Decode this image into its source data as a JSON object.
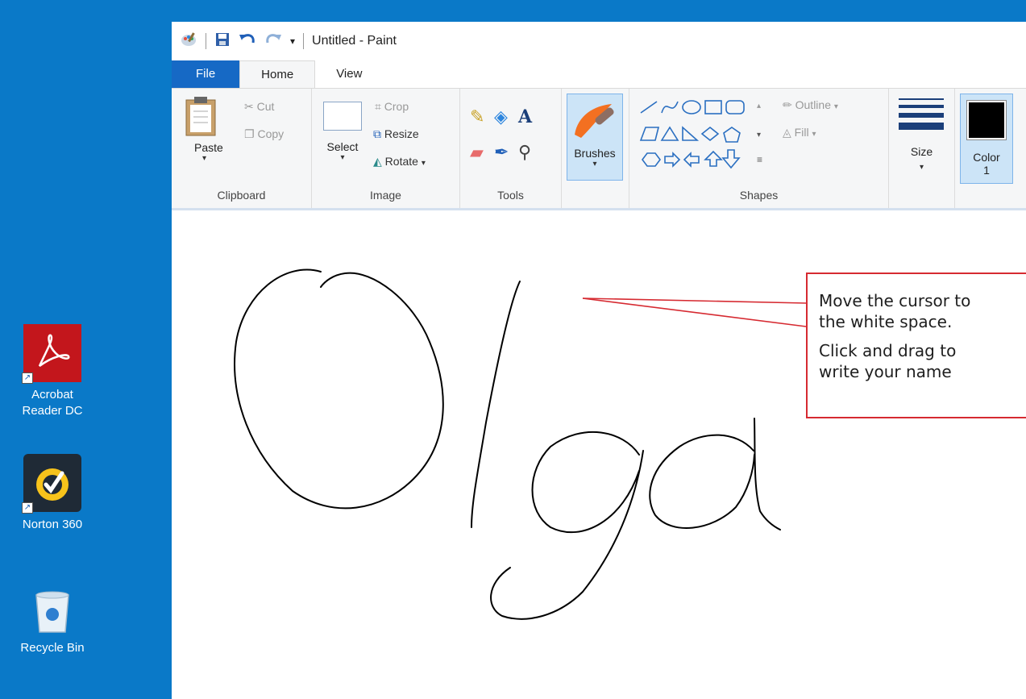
{
  "desktop": {
    "icons": [
      {
        "label_line1": "Acrobat",
        "label_line2": "Reader DC",
        "icon": "acrobat-icon"
      },
      {
        "label": "Norton 360",
        "icon": "norton-icon"
      },
      {
        "label": "Recycle Bin",
        "icon": "recycle-bin-icon"
      }
    ]
  },
  "window": {
    "title": "Untitled - Paint",
    "tabs": [
      "File",
      "Home",
      "View"
    ],
    "ribbon": {
      "clipboard": {
        "label": "Clipboard",
        "paste": "Paste",
        "cut": "Cut",
        "copy": "Copy"
      },
      "image": {
        "label": "Image",
        "select": "Select",
        "crop": "Crop",
        "resize": "Resize",
        "rotate": "Rotate"
      },
      "tools": {
        "label": "Tools"
      },
      "brushes": {
        "label": "Brushes"
      },
      "shapes": {
        "label": "Shapes",
        "outline": "Outline",
        "fill": "Fill"
      },
      "size": {
        "label": "Size"
      },
      "color1": {
        "label_line1": "Color",
        "label_line2": "1",
        "value": "#000000"
      }
    }
  },
  "callout": {
    "line1": "Move the cursor to",
    "line2": "the white space.",
    "line3": "Click and drag to",
    "line4": "write your name"
  },
  "canvas": {
    "handwritten_text": "Olga"
  },
  "colors": {
    "desktop_bg": "#0a79c8",
    "file_tab": "#1669c5",
    "callout_border": "#d62a31"
  }
}
